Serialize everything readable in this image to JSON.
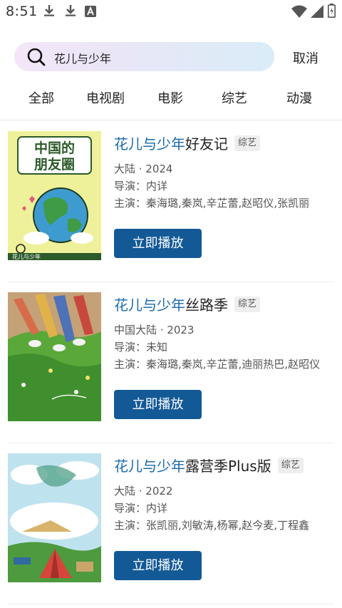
{
  "status_bar": {
    "time": "8:51",
    "left_icons": [
      "download-icon",
      "download-icon",
      "app-a-icon"
    ],
    "right_icons": [
      "wifi-icon",
      "signal-icon",
      "battery-icon"
    ]
  },
  "search": {
    "query": "花儿与少年",
    "cancel_label": "取消"
  },
  "tabs": [
    {
      "label": "全部",
      "active": true
    },
    {
      "label": "电视剧",
      "active": false
    },
    {
      "label": "电影",
      "active": false
    },
    {
      "label": "综艺",
      "active": false
    },
    {
      "label": "动漫",
      "active": false
    }
  ],
  "results": [
    {
      "title_highlight": "花儿与少年",
      "title_rest": "好友记",
      "badge": "综艺",
      "region_year": "大陆 · 2024",
      "director": "导演：内详",
      "cast": "主演：秦海璐,秦岚,辛芷蕾,赵昭仪,张凯丽",
      "button": "立即播放",
      "poster_art": {
        "text_lines": [
          "中国的",
          "朋友圈"
        ],
        "sub_text": "花儿与少年",
        "bg": "#eef19a"
      }
    },
    {
      "title_highlight": "花儿与少年",
      "title_rest": "丝路季",
      "badge": "综艺",
      "region_year": "中国大陆 · 2023",
      "director": "导演：未知",
      "cast": "主演：秦海璐,秦岚,辛芷蕾,迪丽热巴,赵昭仪",
      "button": "立即播放",
      "poster_art": {
        "bg": "#5aa83a"
      }
    },
    {
      "title_highlight": "花儿与少年",
      "title_rest": "露营季Plus版",
      "badge": "综艺",
      "region_year": "大陆 · 2022",
      "director": "导演：内详",
      "cast": "主演：张凯丽,刘敏涛,杨幂,赵今麦,丁程鑫",
      "button": "立即播放",
      "poster_art": {
        "bg": "#bfe3ee"
      }
    }
  ],
  "colors": {
    "accent": "#1a74c9",
    "highlight": "#1a6aad",
    "button": "#135996"
  }
}
